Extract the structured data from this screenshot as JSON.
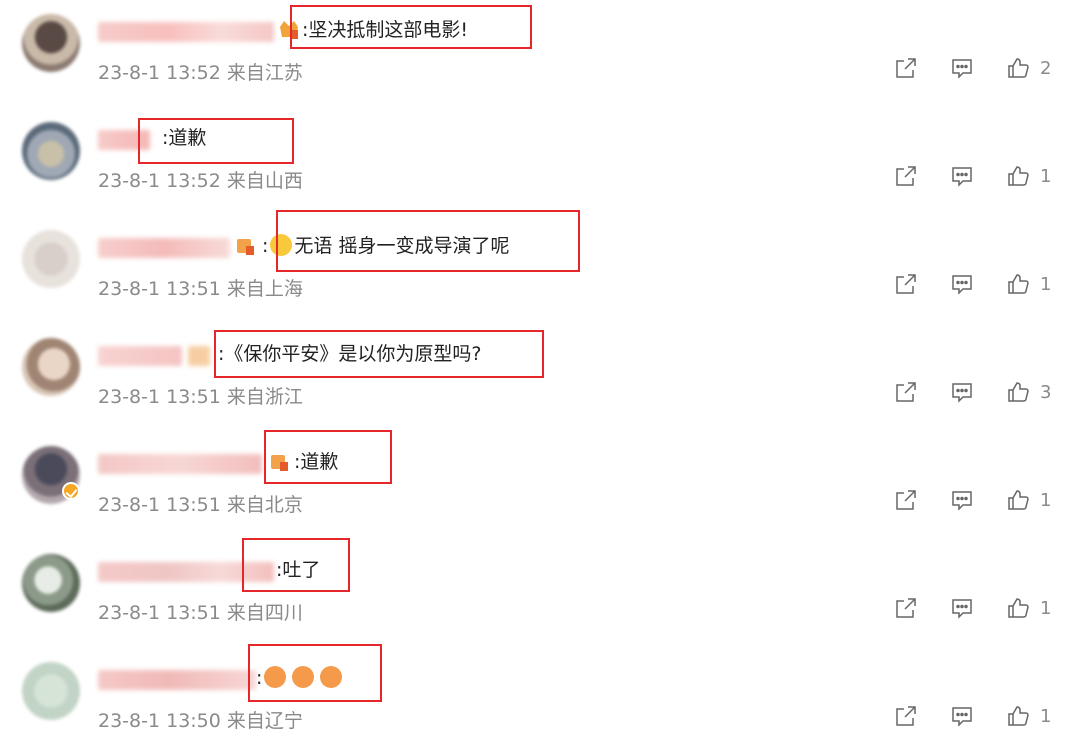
{
  "comments": [
    {
      "text": ":坚决抵制这部电影!",
      "date": "23-8-1 13:52",
      "location": "来自江苏",
      "likes": "2"
    },
    {
      "text": ":道歉",
      "date": "23-8-1 13:52",
      "location": "来自山西",
      "likes": "1"
    },
    {
      "text_before": ":",
      "text": "无语 摇身一变成导演了呢",
      "date": "23-8-1 13:51",
      "location": "来自上海",
      "likes": "1",
      "emoji": "speechless-emoji"
    },
    {
      "text": ":《保你平安》是以你为原型吗?",
      "date": "23-8-1 13:51",
      "location": "来自浙江",
      "likes": "3"
    },
    {
      "text": ":道歉",
      "date": "23-8-1 13:51",
      "location": "来自北京",
      "likes": "1"
    },
    {
      "text": ":吐了",
      "date": "23-8-1 13:51",
      "location": "来自四川",
      "likes": "1"
    },
    {
      "text": ":",
      "date": "23-8-1 13:50",
      "location": "来自辽宁",
      "likes": "1",
      "emoji": "vomit-emoji"
    }
  ],
  "icons": {
    "share": "share-icon",
    "comment": "comment-icon",
    "like": "thumbs-up-icon"
  },
  "colors": {
    "highlight": "#e5262b",
    "meta": "#8a8a8a",
    "text": "#222222"
  }
}
